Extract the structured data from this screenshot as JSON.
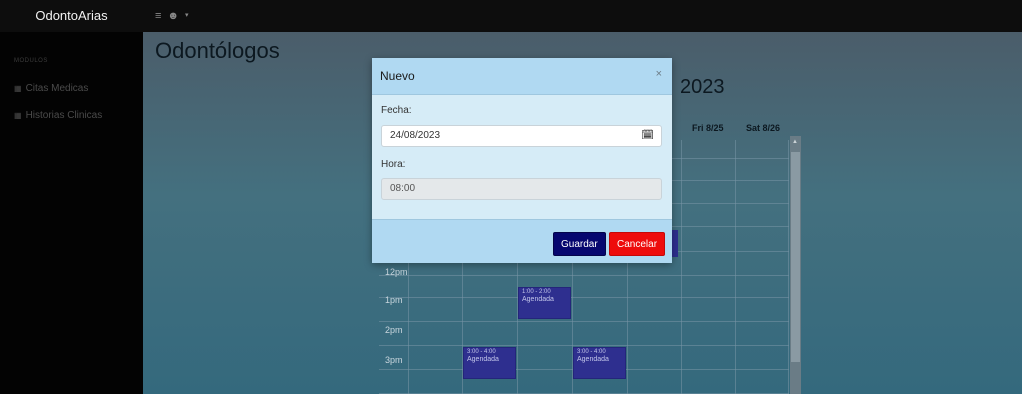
{
  "topbar": {
    "brand": "OdontoArias",
    "icons": [
      "menu-icon",
      "user-icon",
      "caret-down-icon"
    ]
  },
  "sidebar": {
    "section_header": "MODULOS",
    "items": [
      {
        "label": "Citas Medicas",
        "icon": "grid-icon"
      },
      {
        "label": "Historias Clinicas",
        "icon": "grid-icon"
      }
    ]
  },
  "main": {
    "page_title": "Odontólogos",
    "calendar_title": "2023",
    "day_headers": [
      "Fri 8/25",
      "Sat 8/26"
    ],
    "time_labels": [
      "12pm",
      "1pm",
      "2pm",
      "3pm"
    ],
    "events": [
      {
        "time": "1:00 - 2:00",
        "status": "Agendada"
      },
      {
        "time": "3:00 - 4:00",
        "status": "Agendada"
      },
      {
        "time": "3:00 - 4:00",
        "status": "Agendada"
      }
    ]
  },
  "modal": {
    "title": "Nuevo",
    "close_glyph": "×",
    "date_label": "Fecha:",
    "date_value": "24/08/2023",
    "time_label": "Hora:",
    "time_value": "08:00",
    "save_label": "Guardar",
    "cancel_label": "Cancelar"
  },
  "colors": {
    "topbar": "#0d0d0d",
    "sidebar": "#030303",
    "modal_header": "#b0d9f2",
    "modal_body": "#d6ecf7",
    "event": "#2e2f8f",
    "save_button": "#06066f",
    "cancel_button": "#ee0c0c"
  }
}
